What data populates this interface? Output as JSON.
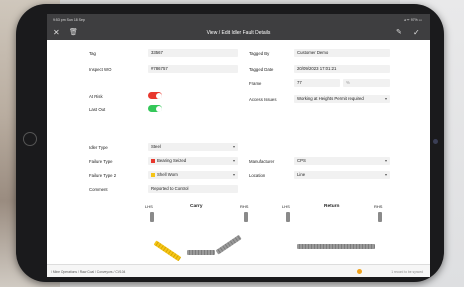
{
  "status_bar": {
    "time": "9:53 pm Sun 18 Sep",
    "right": "◂ ᯤ 97% ▭"
  },
  "title_bar": {
    "title": "View / Edit Idler Fault Details"
  },
  "form": {
    "tag_label": "Tag",
    "tag_value": "33567",
    "inspect_wo_label": "Inspect WO",
    "inspect_wo_value": "#786757",
    "tagged_by_label": "Tagged By",
    "tagged_by_value": "Customer Demo",
    "tagged_date_label": "Tagged Date",
    "tagged_date_value": "20/09/2023 17:01:21",
    "frame_label": "Frame",
    "frame_value": "77",
    "frame_secondary": "%",
    "at_risk_label": "At Risk",
    "at_risk_on": true,
    "last_out_label": "Last Out",
    "last_out_on": true,
    "access_issues_label": "Access Issues",
    "access_issues_value": "Working at Heights Permit required",
    "idler_type_label": "Idler Type",
    "idler_type_value": "Steel",
    "failure_type_label": "Failure Type",
    "failure_type_value": "Bearing Seized",
    "failure_type_color": "#e8382e",
    "failure_type2_label": "Failure Type 2",
    "failure_type2_value": "Shell Worn",
    "failure_type2_color": "#f5c518",
    "manufacturer_label": "Manufacturer",
    "manufacturer_value": "CPS",
    "location_label": "Location",
    "location_value": "Line",
    "comment_label": "Comment",
    "comment_value": "Reported to Control"
  },
  "diagram": {
    "carry": {
      "lhs": "LHS",
      "title": "Carry",
      "rhs": "RHS",
      "highlight_color": "#f5c518"
    },
    "return": {
      "lhs": "LHS",
      "title": "Return",
      "rhs": "RHS"
    }
  },
  "footer": {
    "breadcrumb": "/ Mine Operations / Raw Coal / Conveyors / CV104",
    "status": "1 record to be synced",
    "status_color": "#f0a21c"
  },
  "colors": {
    "toggle_green": "#34c759",
    "toggle_red": "#e8382e",
    "bar_bg": "#3e3e40"
  }
}
